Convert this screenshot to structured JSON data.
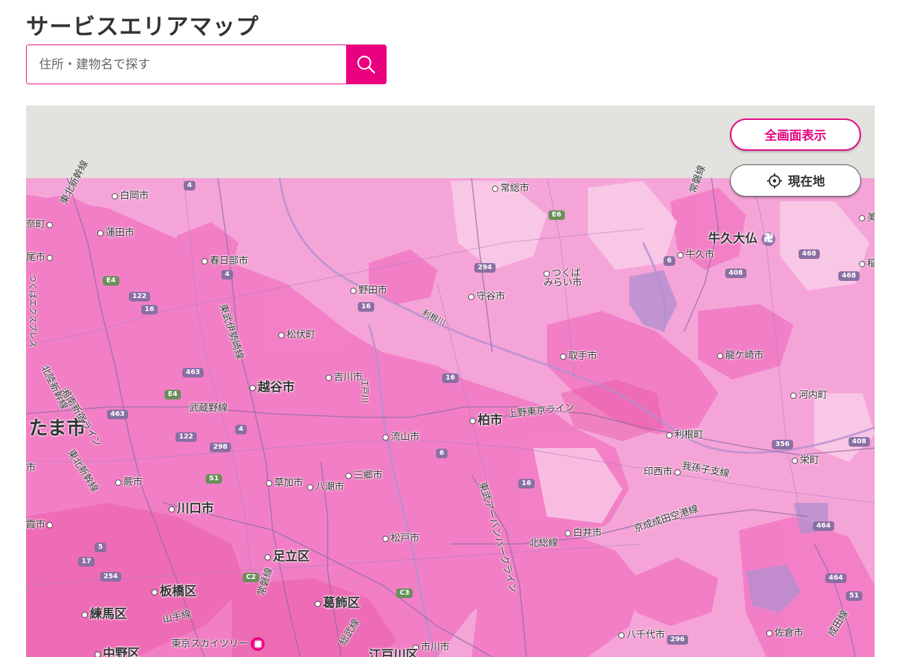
{
  "header": {
    "title": "サービスエリアマップ"
  },
  "search": {
    "placeholder": "住所・建物名で探す",
    "icon": "search-icon"
  },
  "map": {
    "buttons": {
      "fullscreen_label": "全画面表示",
      "current_location_label": "現在地"
    },
    "colors": {
      "coverage": "#f27ec6",
      "coverage_light": "#f5a4d8",
      "accent": "#e4007f",
      "outside_coverage": "#e4e2df"
    },
    "places": [
      {
        "id": "shiraoka",
        "label": "白岡市"
      },
      {
        "id": "hasuda",
        "label": "蓮田市"
      },
      {
        "id": "kasukabe",
        "label": "春日部市"
      },
      {
        "id": "noda",
        "label": "野田市"
      },
      {
        "id": "moriya",
        "label": "守谷市"
      },
      {
        "id": "joso",
        "label": "常総市"
      },
      {
        "id": "tsukuba",
        "label": "つくば\nみらい市"
      },
      {
        "id": "ushiku",
        "label": "牛久市"
      },
      {
        "id": "ushiku-daibutsu",
        "label": "牛久大仏"
      },
      {
        "id": "matsubushi",
        "label": "松伏町"
      },
      {
        "id": "toride",
        "label": "取手市"
      },
      {
        "id": "ryugasaki",
        "label": "龍ケ崎市"
      },
      {
        "id": "koshigaya",
        "label": "越谷市"
      },
      {
        "id": "yoshikawa",
        "label": "吉川市"
      },
      {
        "id": "kashiwa",
        "label": "柏市"
      },
      {
        "id": "kawachi",
        "label": "河内町"
      },
      {
        "id": "saitama",
        "label": "たま市"
      },
      {
        "id": "nagareyama",
        "label": "流山市"
      },
      {
        "id": "tone",
        "label": "利根町"
      },
      {
        "id": "sakae",
        "label": "栄町"
      },
      {
        "id": "misato",
        "label": "三郷市"
      },
      {
        "id": "inzai",
        "label": "印西市"
      },
      {
        "id": "warabi",
        "label": "蕨市"
      },
      {
        "id": "soka",
        "label": "草加市"
      },
      {
        "id": "yashio",
        "label": "八潮市"
      },
      {
        "id": "kawaguchi",
        "label": "川口市"
      },
      {
        "id": "matsudo",
        "label": "松戸市"
      },
      {
        "id": "shiroi",
        "label": "白井市"
      },
      {
        "id": "adachi",
        "label": "足立区"
      },
      {
        "id": "itabashi",
        "label": "板橋区"
      },
      {
        "id": "katsushika",
        "label": "葛飾区"
      },
      {
        "id": "nerima",
        "label": "練馬区"
      },
      {
        "id": "yachiyo",
        "label": "八千代市"
      },
      {
        "id": "sakura",
        "label": "佐倉市"
      },
      {
        "id": "ichikawa",
        "label": "市川市"
      },
      {
        "id": "edogawa",
        "label": "江戸川区"
      },
      {
        "id": "nakano",
        "label": "中野区"
      },
      {
        "id": "skytree",
        "label": "東京スカイツリー"
      },
      {
        "id": "okegawa",
        "label": "奈町"
      },
      {
        "id": "ageo",
        "label": "尾市"
      },
      {
        "id": "asaka",
        "label": "霞市"
      },
      {
        "id": "mi",
        "label": "美"
      },
      {
        "id": "ina",
        "label": "稲"
      },
      {
        "id": "toda",
        "label": "市"
      }
    ],
    "lines": [
      {
        "id": "tohoku-shinkansen",
        "label": "東北新幹線"
      },
      {
        "id": "tobu-isesaki",
        "label": "東武伊勢崎線"
      },
      {
        "id": "tonegawa",
        "label": "利根川"
      },
      {
        "id": "musashino",
        "label": "武蔵野線"
      },
      {
        "id": "ueno-tokyo",
        "label": "上野東京ライン"
      },
      {
        "id": "abiko-branch",
        "label": "我孫子支線"
      },
      {
        "id": "keisei-narita",
        "label": "京成成田空港線"
      },
      {
        "id": "hokuso",
        "label": "北総線"
      },
      {
        "id": "tobu-urban",
        "label": "東武アーバンパークライン"
      },
      {
        "id": "hokuriku",
        "label": "北陸新幹線"
      },
      {
        "id": "shonan",
        "label": "湘南新宿ライン"
      },
      {
        "id": "tohoku-shinkansen-2",
        "label": "東北新幹線"
      },
      {
        "id": "tsukuba-express",
        "label": "つくばエクスプレス"
      },
      {
        "id": "edogawa-river",
        "label": "江戸川"
      },
      {
        "id": "joban",
        "label": "常磐線"
      },
      {
        "id": "joban-2",
        "label": "常磐線"
      },
      {
        "id": "yamanote",
        "label": "山手線"
      },
      {
        "id": "sobu",
        "label": "総武線"
      },
      {
        "id": "narita",
        "label": "成田線"
      }
    ],
    "road_shields": [
      {
        "id": "r4a",
        "label": "4"
      },
      {
        "id": "r4b",
        "label": "4"
      },
      {
        "id": "r4c",
        "label": "4"
      },
      {
        "id": "e6",
        "label": "E6"
      },
      {
        "id": "r294",
        "label": "294"
      },
      {
        "id": "r6a",
        "label": "6"
      },
      {
        "id": "r468a",
        "label": "468"
      },
      {
        "id": "r408a",
        "label": "408"
      },
      {
        "id": "r468b",
        "label": "468"
      },
      {
        "id": "e4a",
        "label": "E4"
      },
      {
        "id": "r122a",
        "label": "122"
      },
      {
        "id": "r16a",
        "label": "16"
      },
      {
        "id": "r16b",
        "label": "16"
      },
      {
        "id": "r463a",
        "label": "463"
      },
      {
        "id": "r16c",
        "label": "16"
      },
      {
        "id": "e4b",
        "label": "E4"
      },
      {
        "id": "r463b",
        "label": "463"
      },
      {
        "id": "r122b",
        "label": "122"
      },
      {
        "id": "r298",
        "label": "298"
      },
      {
        "id": "r6b",
        "label": "6"
      },
      {
        "id": "r356",
        "label": "356"
      },
      {
        "id": "r408b",
        "label": "408"
      },
      {
        "id": "s1",
        "label": "S1"
      },
      {
        "id": "r16d",
        "label": "16"
      },
      {
        "id": "r5",
        "label": "5"
      },
      {
        "id": "r464a",
        "label": "464"
      },
      {
        "id": "r17",
        "label": "17"
      },
      {
        "id": "r254",
        "label": "254"
      },
      {
        "id": "c2",
        "label": "C2"
      },
      {
        "id": "c3",
        "label": "C3"
      },
      {
        "id": "r464b",
        "label": "464"
      },
      {
        "id": "r51",
        "label": "51"
      },
      {
        "id": "r296",
        "label": "296"
      }
    ]
  }
}
